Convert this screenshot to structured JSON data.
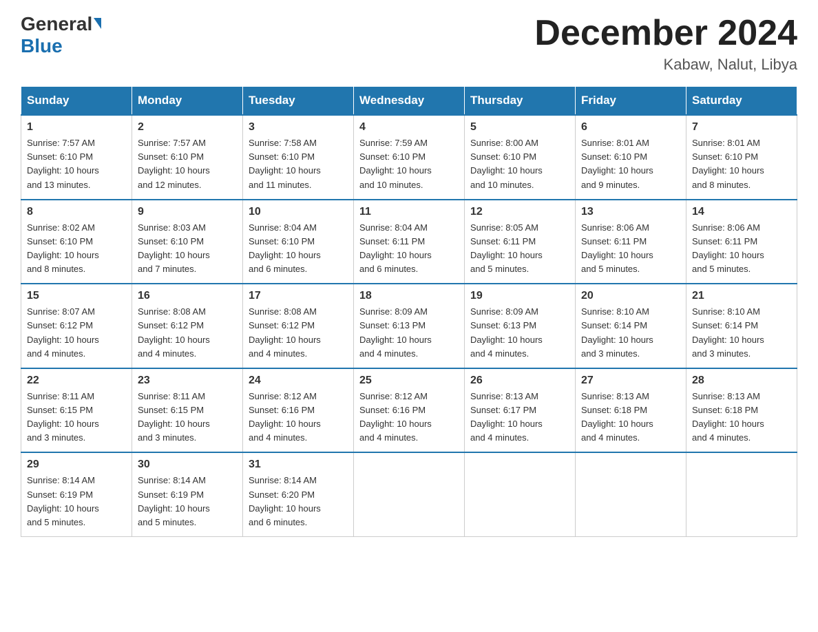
{
  "logo": {
    "general": "General",
    "blue": "Blue"
  },
  "header": {
    "title": "December 2024",
    "subtitle": "Kabaw, Nalut, Libya"
  },
  "days_of_week": [
    "Sunday",
    "Monday",
    "Tuesday",
    "Wednesday",
    "Thursday",
    "Friday",
    "Saturday"
  ],
  "weeks": [
    [
      {
        "day": "1",
        "info": "Sunrise: 7:57 AM\nSunset: 6:10 PM\nDaylight: 10 hours\nand 13 minutes."
      },
      {
        "day": "2",
        "info": "Sunrise: 7:57 AM\nSunset: 6:10 PM\nDaylight: 10 hours\nand 12 minutes."
      },
      {
        "day": "3",
        "info": "Sunrise: 7:58 AM\nSunset: 6:10 PM\nDaylight: 10 hours\nand 11 minutes."
      },
      {
        "day": "4",
        "info": "Sunrise: 7:59 AM\nSunset: 6:10 PM\nDaylight: 10 hours\nand 10 minutes."
      },
      {
        "day": "5",
        "info": "Sunrise: 8:00 AM\nSunset: 6:10 PM\nDaylight: 10 hours\nand 10 minutes."
      },
      {
        "day": "6",
        "info": "Sunrise: 8:01 AM\nSunset: 6:10 PM\nDaylight: 10 hours\nand 9 minutes."
      },
      {
        "day": "7",
        "info": "Sunrise: 8:01 AM\nSunset: 6:10 PM\nDaylight: 10 hours\nand 8 minutes."
      }
    ],
    [
      {
        "day": "8",
        "info": "Sunrise: 8:02 AM\nSunset: 6:10 PM\nDaylight: 10 hours\nand 8 minutes."
      },
      {
        "day": "9",
        "info": "Sunrise: 8:03 AM\nSunset: 6:10 PM\nDaylight: 10 hours\nand 7 minutes."
      },
      {
        "day": "10",
        "info": "Sunrise: 8:04 AM\nSunset: 6:10 PM\nDaylight: 10 hours\nand 6 minutes."
      },
      {
        "day": "11",
        "info": "Sunrise: 8:04 AM\nSunset: 6:11 PM\nDaylight: 10 hours\nand 6 minutes."
      },
      {
        "day": "12",
        "info": "Sunrise: 8:05 AM\nSunset: 6:11 PM\nDaylight: 10 hours\nand 5 minutes."
      },
      {
        "day": "13",
        "info": "Sunrise: 8:06 AM\nSunset: 6:11 PM\nDaylight: 10 hours\nand 5 minutes."
      },
      {
        "day": "14",
        "info": "Sunrise: 8:06 AM\nSunset: 6:11 PM\nDaylight: 10 hours\nand 5 minutes."
      }
    ],
    [
      {
        "day": "15",
        "info": "Sunrise: 8:07 AM\nSunset: 6:12 PM\nDaylight: 10 hours\nand 4 minutes."
      },
      {
        "day": "16",
        "info": "Sunrise: 8:08 AM\nSunset: 6:12 PM\nDaylight: 10 hours\nand 4 minutes."
      },
      {
        "day": "17",
        "info": "Sunrise: 8:08 AM\nSunset: 6:12 PM\nDaylight: 10 hours\nand 4 minutes."
      },
      {
        "day": "18",
        "info": "Sunrise: 8:09 AM\nSunset: 6:13 PM\nDaylight: 10 hours\nand 4 minutes."
      },
      {
        "day": "19",
        "info": "Sunrise: 8:09 AM\nSunset: 6:13 PM\nDaylight: 10 hours\nand 4 minutes."
      },
      {
        "day": "20",
        "info": "Sunrise: 8:10 AM\nSunset: 6:14 PM\nDaylight: 10 hours\nand 3 minutes."
      },
      {
        "day": "21",
        "info": "Sunrise: 8:10 AM\nSunset: 6:14 PM\nDaylight: 10 hours\nand 3 minutes."
      }
    ],
    [
      {
        "day": "22",
        "info": "Sunrise: 8:11 AM\nSunset: 6:15 PM\nDaylight: 10 hours\nand 3 minutes."
      },
      {
        "day": "23",
        "info": "Sunrise: 8:11 AM\nSunset: 6:15 PM\nDaylight: 10 hours\nand 3 minutes."
      },
      {
        "day": "24",
        "info": "Sunrise: 8:12 AM\nSunset: 6:16 PM\nDaylight: 10 hours\nand 4 minutes."
      },
      {
        "day": "25",
        "info": "Sunrise: 8:12 AM\nSunset: 6:16 PM\nDaylight: 10 hours\nand 4 minutes."
      },
      {
        "day": "26",
        "info": "Sunrise: 8:13 AM\nSunset: 6:17 PM\nDaylight: 10 hours\nand 4 minutes."
      },
      {
        "day": "27",
        "info": "Sunrise: 8:13 AM\nSunset: 6:18 PM\nDaylight: 10 hours\nand 4 minutes."
      },
      {
        "day": "28",
        "info": "Sunrise: 8:13 AM\nSunset: 6:18 PM\nDaylight: 10 hours\nand 4 minutes."
      }
    ],
    [
      {
        "day": "29",
        "info": "Sunrise: 8:14 AM\nSunset: 6:19 PM\nDaylight: 10 hours\nand 5 minutes."
      },
      {
        "day": "30",
        "info": "Sunrise: 8:14 AM\nSunset: 6:19 PM\nDaylight: 10 hours\nand 5 minutes."
      },
      {
        "day": "31",
        "info": "Sunrise: 8:14 AM\nSunset: 6:20 PM\nDaylight: 10 hours\nand 6 minutes."
      },
      {
        "day": "",
        "info": ""
      },
      {
        "day": "",
        "info": ""
      },
      {
        "day": "",
        "info": ""
      },
      {
        "day": "",
        "info": ""
      }
    ]
  ]
}
